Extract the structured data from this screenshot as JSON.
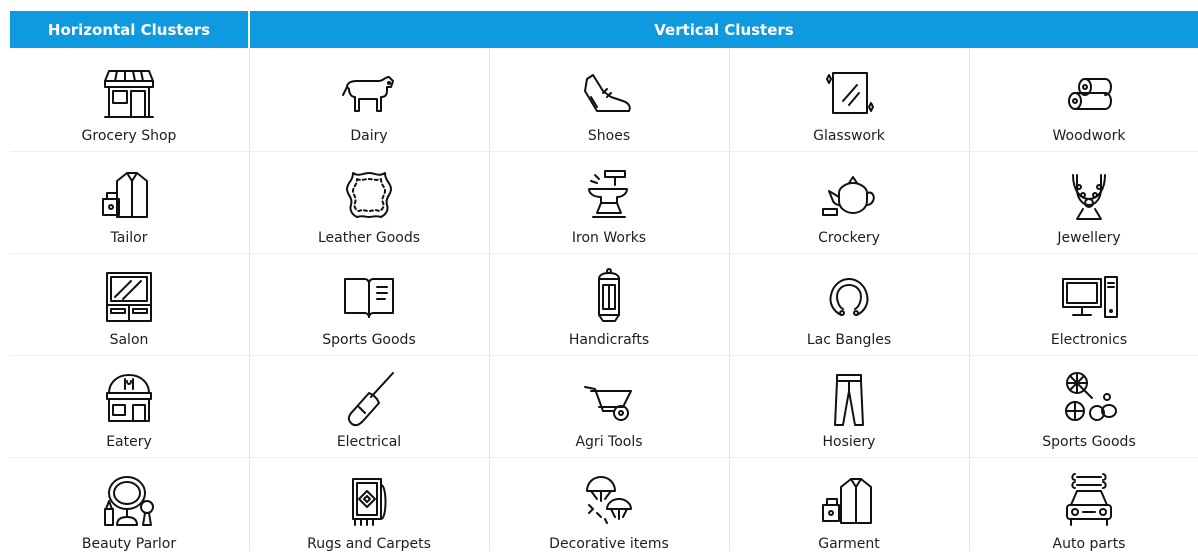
{
  "header": {
    "horizontal_title": "Horizontal Clusters",
    "vertical_title": "Vertical Clusters"
  },
  "accent_color": "#0f9ae0",
  "rows": [
    [
      {
        "label": "Grocery Shop",
        "icon": "grocery-shop-icon"
      },
      {
        "label": "Dairy",
        "icon": "cow-icon"
      },
      {
        "label": "Shoes",
        "icon": "shoe-icon"
      },
      {
        "label": "Glasswork",
        "icon": "glass-pane-icon"
      },
      {
        "label": "Woodwork",
        "icon": "wood-logs-icon"
      }
    ],
    [
      {
        "label": "Tailor",
        "icon": "tailor-icon"
      },
      {
        "label": "Leather Goods",
        "icon": "leather-hide-icon"
      },
      {
        "label": "Iron Works",
        "icon": "anvil-icon"
      },
      {
        "label": "Crockery",
        "icon": "teapot-icon"
      },
      {
        "label": "Jewellery",
        "icon": "necklace-icon"
      }
    ],
    [
      {
        "label": "Salon",
        "icon": "salon-mirror-icon"
      },
      {
        "label": "Sports Goods",
        "icon": "book-icon"
      },
      {
        "label": "Handicrafts",
        "icon": "lantern-icon"
      },
      {
        "label": "Lac Bangles",
        "icon": "bangle-icon"
      },
      {
        "label": "Electronics",
        "icon": "computer-icon"
      }
    ],
    [
      {
        "label": "Eatery",
        "icon": "restaurant-icon"
      },
      {
        "label": "Electrical",
        "icon": "screwdriver-icon"
      },
      {
        "label": "Agri Tools",
        "icon": "wheelbarrow-icon"
      },
      {
        "label": "Hosiery",
        "icon": "trousers-icon"
      },
      {
        "label": "Sports Goods",
        "icon": "sports-balls-icon"
      }
    ],
    [
      {
        "label": "Beauty Parlor",
        "icon": "beauty-mirror-icon"
      },
      {
        "label": "Rugs and Carpets",
        "icon": "rug-icon"
      },
      {
        "label": "Decorative items",
        "icon": "decorative-lamps-icon"
      },
      {
        "label": "Garment",
        "icon": "garment-icon"
      },
      {
        "label": "Auto parts",
        "icon": "car-icon"
      }
    ]
  ]
}
